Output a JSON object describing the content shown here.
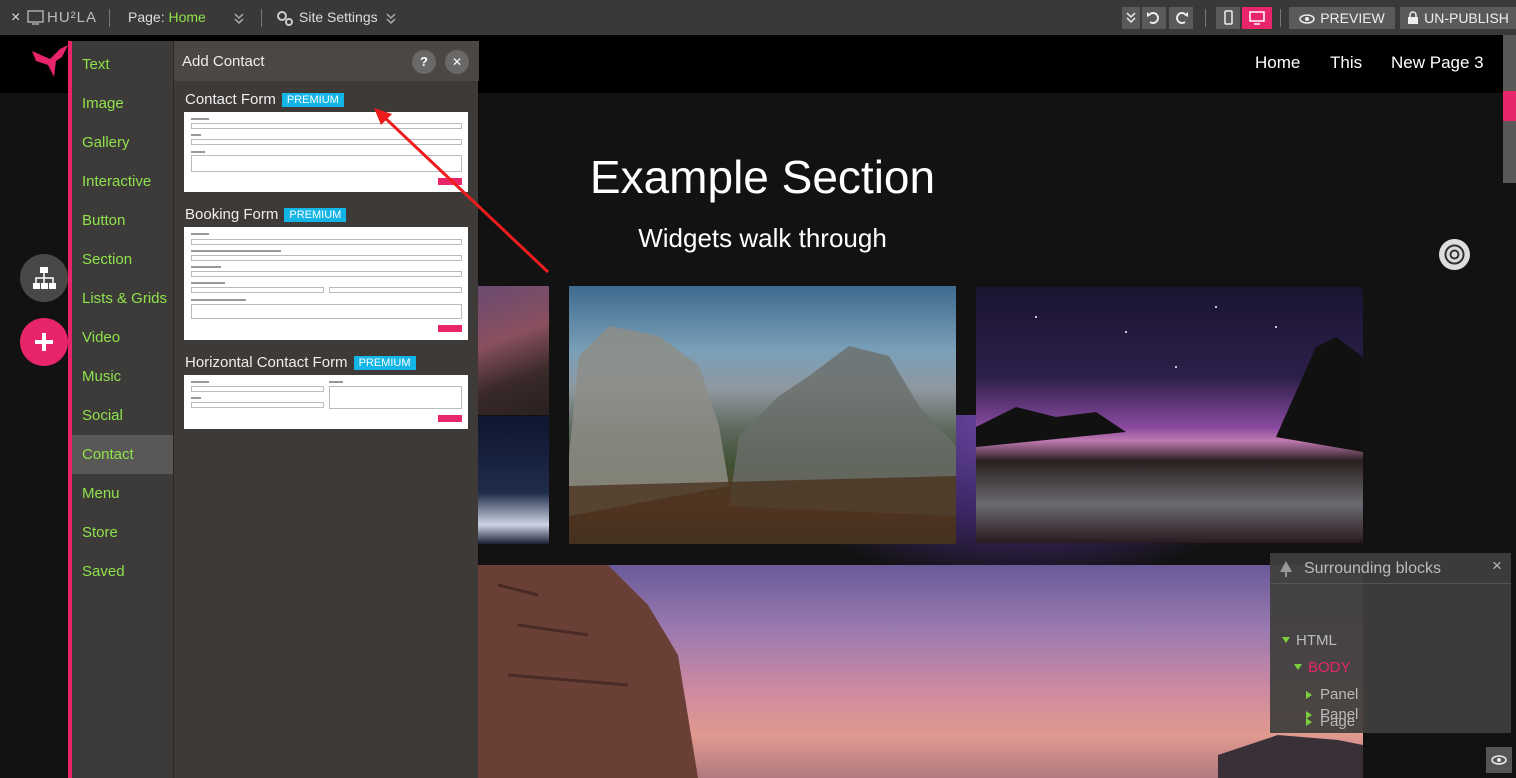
{
  "topbar": {
    "close_glyph": "×",
    "logo": "HU²LA",
    "page_label": "Page:",
    "page_value": "Home",
    "site_settings": "Site Settings",
    "preview": "PREVIEW",
    "unpublish": "UN-PUBLISH"
  },
  "site": {
    "nav": [
      "Home",
      "This",
      "New Page 3"
    ],
    "section_title": "Example Section",
    "section_subtitle": "Widgets walk through"
  },
  "sidebar": {
    "items": [
      {
        "label": "Text"
      },
      {
        "label": "Image"
      },
      {
        "label": "Gallery"
      },
      {
        "label": "Interactive"
      },
      {
        "label": "Button"
      },
      {
        "label": "Section"
      },
      {
        "label": "Lists & Grids"
      },
      {
        "label": "Video"
      },
      {
        "label": "Music"
      },
      {
        "label": "Social"
      },
      {
        "label": "Contact"
      },
      {
        "label": "Menu"
      },
      {
        "label": "Store"
      },
      {
        "label": "Saved"
      }
    ],
    "active": "Contact"
  },
  "panel": {
    "title": "Add Contact",
    "help_glyph": "?",
    "close_glyph": "✕",
    "widgets": [
      {
        "title": "Contact Form",
        "badge": "PREMIUM"
      },
      {
        "title": "Booking Form",
        "badge": "PREMIUM"
      },
      {
        "title": "Horizontal Contact Form",
        "badge": "PREMIUM"
      }
    ]
  },
  "surrounding": {
    "title": "Surrounding blocks",
    "close_glyph": "×",
    "tree": [
      "HTML",
      "BODY",
      "Panel",
      "Page",
      "Panel"
    ]
  },
  "icons": {
    "close": "close-icon",
    "eye": "eye-icon",
    "gear": "gear-icon",
    "undo": "undo-icon",
    "redo": "redo-icon",
    "mobile": "mobile-icon",
    "desktop": "desktop-icon",
    "lock": "lock-icon",
    "sitemap": "sitemap-icon",
    "plus": "plus-icon",
    "tree": "tree-icon"
  },
  "colors": {
    "accent_pink": "#e8256b",
    "accent_green": "#8ee24b",
    "premium_blue": "#12b5e6",
    "toolbar_bg": "#3b3937",
    "panel_bg": "#3d3a38"
  }
}
